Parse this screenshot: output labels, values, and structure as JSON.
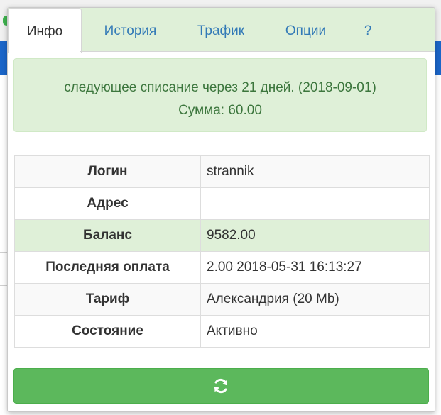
{
  "popup": {
    "tabs": [
      {
        "label": "Инфо",
        "active": true
      },
      {
        "label": "История",
        "active": false
      },
      {
        "label": "Трафик",
        "active": false
      },
      {
        "label": "Опции",
        "active": false
      },
      {
        "label": "?",
        "active": false
      }
    ],
    "alert": {
      "line1": "следующее списание через 21 дней. (2018-09-01)",
      "line2": "Сумма: 60.00"
    },
    "info_table": {
      "rows": [
        {
          "label": "Логин",
          "value": "strannik"
        },
        {
          "label": "Адрес",
          "value": ""
        },
        {
          "label": "Баланс",
          "value": "9582.00"
        },
        {
          "label": "Последняя оплата",
          "value": "2.00 2018-05-31 16:13:27"
        },
        {
          "label": "Тариф",
          "value": "Александрия (20 Mb)"
        },
        {
          "label": "Состояние",
          "value": "Активно"
        }
      ]
    },
    "refresh_button": {
      "icon": "refresh-icon"
    }
  },
  "colors": {
    "tab_bar": "#dff0d8",
    "alert_text": "#3c763d",
    "link": "#337ab7",
    "button": "#5cb85c"
  }
}
